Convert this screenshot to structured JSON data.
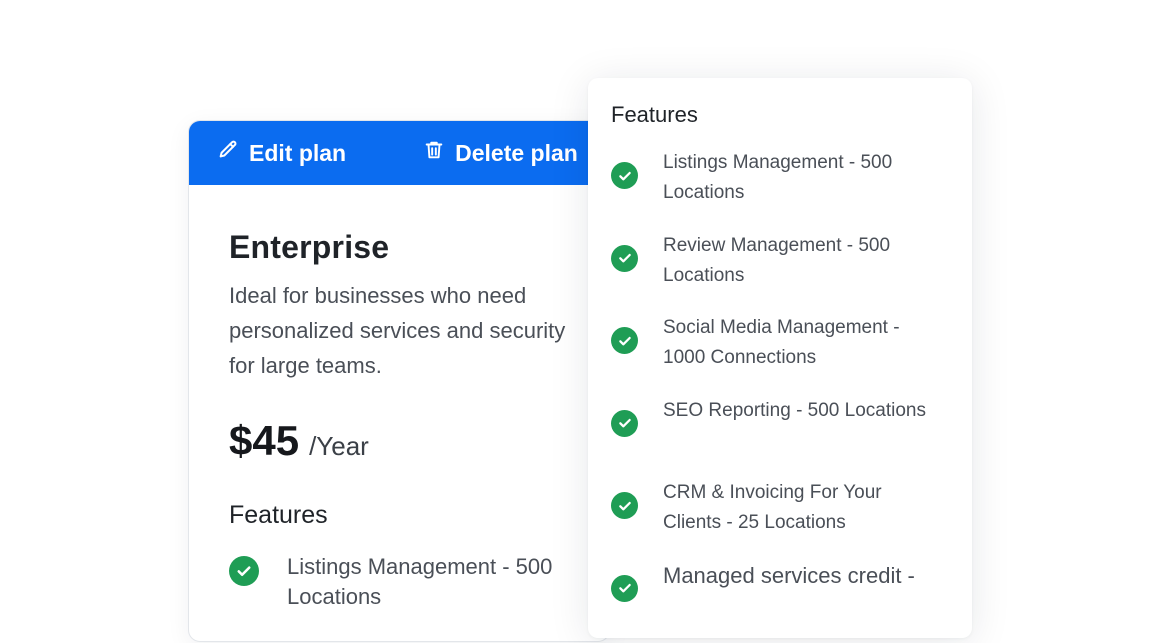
{
  "plan": {
    "toolbar": {
      "edit_label": "Edit plan",
      "delete_label": "Delete plan",
      "bar_color": "#0b6cf0"
    },
    "name": "Enterprise",
    "description": "Ideal for businesses who need personalized services and security for large teams.",
    "price": "$45",
    "period": "/Year",
    "features_title": "Features",
    "features": [
      "Listings Management - 500 Locations"
    ]
  },
  "features_panel": {
    "title": "Features",
    "items": [
      "Listings Management - 500 Locations",
      "Review Management - 500 Locations",
      "Social Media Management - 1000 Connections",
      "SEO Reporting - 500 Locations",
      "CRM & Invoicing For Your Clients - 25 Locations",
      "Managed services credit -"
    ],
    "check_color": "#1f9d55"
  }
}
